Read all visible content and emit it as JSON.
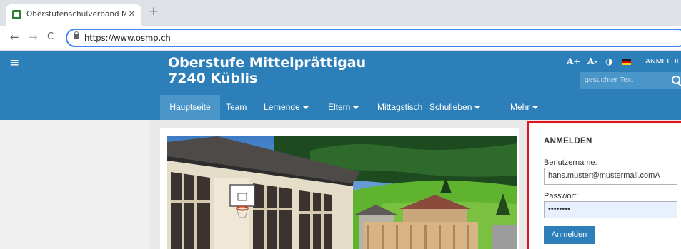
{
  "browser": {
    "tab_title": "Oberstufenschulverband Mittelprättigau",
    "tab_close": "×",
    "new_tab": "+",
    "back": "←",
    "forward": "→",
    "reload": "C",
    "url": "https://www.osmp.ch"
  },
  "header": {
    "menu": "≡",
    "title_line1": "Oberstufe Mittelprättigau",
    "title_line2": "7240 Küblis",
    "font_increase": "A+",
    "font_decrease": "A-",
    "contrast": "◑",
    "language_flag": "german-flag",
    "login_link": "ANMELDEN",
    "search_placeholder": "gesuchter Text"
  },
  "nav": {
    "items": [
      {
        "label": "Hauptseite",
        "active": true,
        "dropdown": false
      },
      {
        "label": "Team",
        "active": false,
        "dropdown": false
      },
      {
        "label": "Lernende",
        "active": false,
        "dropdown": true
      },
      {
        "label": "Eltern",
        "active": false,
        "dropdown": true
      },
      {
        "label": "Mittagstisch",
        "active": false,
        "dropdown": false
      },
      {
        "label": "Schulleben",
        "active": false,
        "dropdown": true
      },
      {
        "label": "Mehr",
        "active": false,
        "dropdown": true
      }
    ]
  },
  "login": {
    "title": "ANMELDEN",
    "username_label": "Benutzername:",
    "username_value": "hans.muster@mustermail.comA",
    "password_label": "Passwort:",
    "password_value": "••••••••",
    "submit": "Anmelden"
  },
  "colors": {
    "brand": "#2c7fb8",
    "highlight": "#e3121b"
  }
}
